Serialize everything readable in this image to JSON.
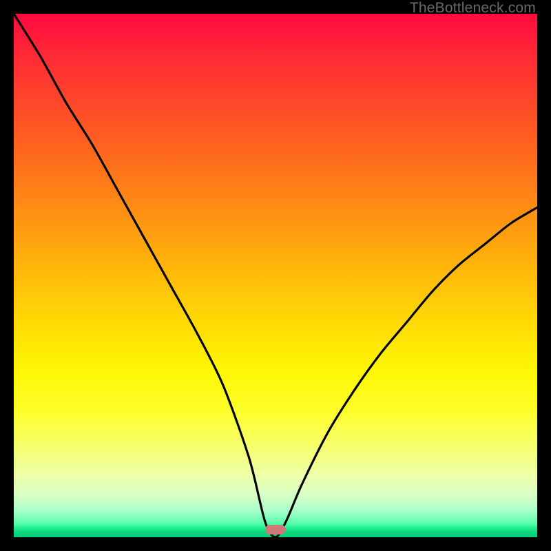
{
  "watermark": "TheBottleneck.com",
  "colors": {
    "frame_bg": "#000000",
    "gradient_top": "#ff0a3e",
    "gradient_bottom": "#05cf78",
    "curve_stroke": "#000000",
    "marker_fill": "#cd7b78",
    "watermark_text": "#6a6a6a"
  },
  "chart_data": {
    "type": "line",
    "title": "",
    "xlabel": "",
    "ylabel": "",
    "xlim": [
      0,
      100
    ],
    "ylim": [
      0,
      100
    ],
    "grid": false,
    "legend": false,
    "series": [
      {
        "name": "bottleneck-curve",
        "x": [
          0,
          5,
          10,
          15,
          20,
          25,
          30,
          35,
          40,
          45,
          48,
          50,
          52,
          55,
          60,
          65,
          70,
          75,
          80,
          85,
          90,
          95,
          100
        ],
        "values": [
          100,
          92,
          83,
          75,
          66,
          57,
          48,
          39,
          29,
          15,
          3,
          0,
          3,
          10,
          20,
          28,
          35,
          41,
          47,
          52,
          56,
          60,
          63
        ]
      }
    ],
    "annotations": [
      {
        "name": "min-marker",
        "x": 50,
        "y": 1.5,
        "shape": "rounded-rect"
      }
    ],
    "background": "vertical-gradient-red-to-green"
  }
}
